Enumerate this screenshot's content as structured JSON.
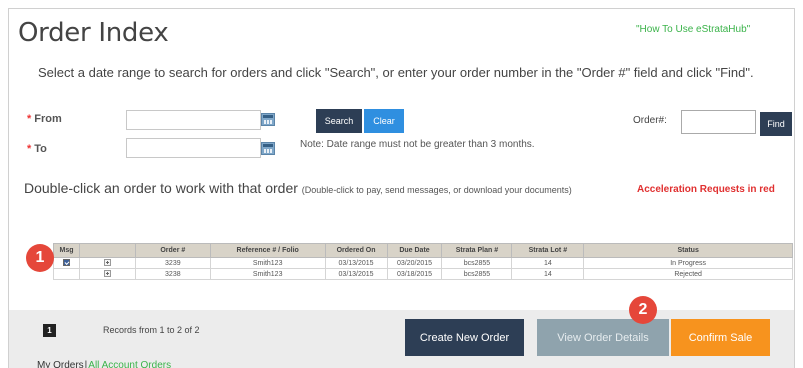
{
  "page": {
    "title": "Order Index",
    "help_link": "\"How To Use eStrataHub\"",
    "instructions": "Select a date range to search for orders and click \"Search\", or enter your order number in the \"Order #\" field and click \"Find\"."
  },
  "search": {
    "from_label": "From",
    "to_label": "To",
    "required_marker": "*",
    "from_value": "",
    "to_value": "",
    "search_button": "Search",
    "clear_button": "Clear",
    "note": "Note: Date range must not be greater than 3 months.",
    "order_label": "Order#:",
    "order_value": "",
    "find_button": "Find"
  },
  "list": {
    "heading": "Double-click an order to work with that order",
    "heading_note": "(Double-click to pay, send messages, or download your documents)",
    "acceleration_note": "Acceleration Requests in red"
  },
  "table": {
    "columns": [
      "Msg",
      "",
      "Order #",
      "Reference # / Folio",
      "Ordered On",
      "Due Date",
      "Strata Plan #",
      "Strata Lot #",
      "Status"
    ],
    "rows": [
      {
        "checked": true,
        "order": "3239",
        "reference": "Smith123",
        "ordered_on": "03/13/2015",
        "due_date": "03/20/2015",
        "plan": "bcs2855",
        "lot": "14",
        "status": "In Progress"
      },
      {
        "checked": false,
        "order": "3238",
        "reference": "Smith123",
        "ordered_on": "03/13/2015",
        "due_date": "03/18/2015",
        "plan": "bcs2855",
        "lot": "14",
        "status": "Rejected"
      }
    ]
  },
  "badges": {
    "one": "1",
    "two": "2"
  },
  "footer": {
    "page_number": "1",
    "records": "Records from 1 to 2 of 2",
    "create_button": "Create New Order",
    "view_button": "View Order Details",
    "confirm_button": "Confirm Sale",
    "my_orders": "My Orders",
    "separator": "|",
    "all_orders": "All Account Orders"
  },
  "colors": {
    "accent_dark": "#2d3e55",
    "accent_blue": "#2f8fe0",
    "accent_orange": "#f7931e",
    "accent_green": "#3bb34a",
    "badge_red": "#e5473a",
    "alert_red": "#e03030"
  },
  "icons": {
    "date_picker": "calendar-icon",
    "row_expand": "plus-icon",
    "message_select": "checkbox-icon"
  }
}
